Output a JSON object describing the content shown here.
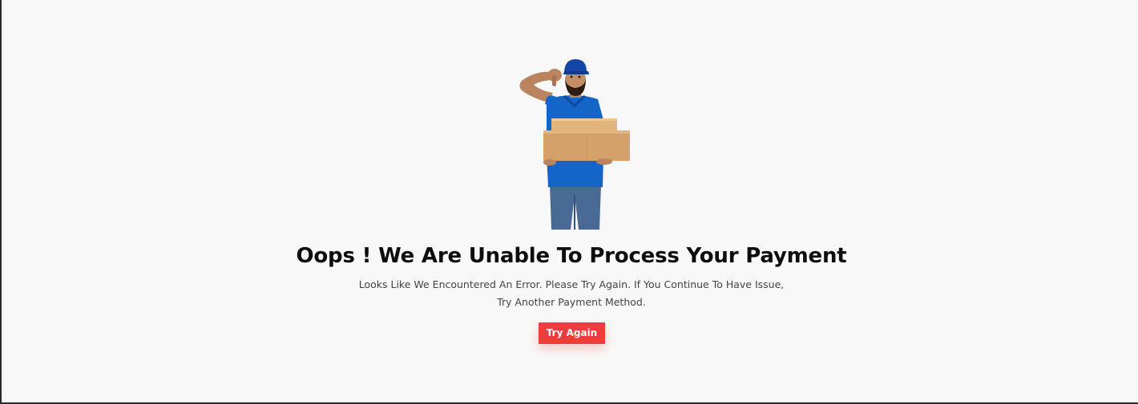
{
  "error_page": {
    "illustration_name": "delivery-man-thumbs-down-with-boxes",
    "title": "Oops ! We Are Unable To Process Your Payment",
    "message_line_1": "Looks Like We Encountered An Error. Please Try Again. If You Continue To Have Issue,",
    "message_line_2": "Try Another Payment Method.",
    "button_label": "Try Again"
  },
  "colors": {
    "background": "#f8f8f8",
    "button": "#ef3d3d",
    "title": "#0d0d0d",
    "text": "#444444"
  }
}
